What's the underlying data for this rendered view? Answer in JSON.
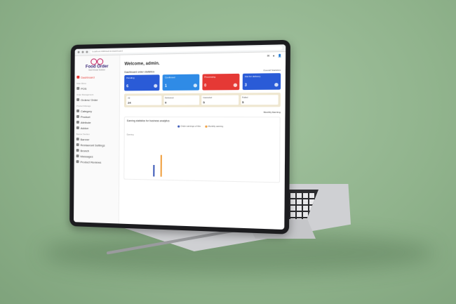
{
  "browser": {
    "url": "localhost:4000/admin/dashboard"
  },
  "brand": {
    "title": "Food Order",
    "subtitle": "Multi Vendor Solution",
    "accent": "#c2185b"
  },
  "sidebar": {
    "sections": [
      "Main Menu",
      "Order Management",
      "Product Manage",
      "Banner Section"
    ],
    "items": [
      {
        "label": "Dashboard",
        "icon": "home-icon",
        "active": true
      },
      {
        "label": "POS",
        "icon": "cart-icon"
      },
      {
        "label": "Orders/ Order",
        "icon": "bag-icon"
      },
      {
        "label": "Category",
        "icon": "grid-icon"
      },
      {
        "label": "Product",
        "icon": "box-icon"
      },
      {
        "label": "Attribute",
        "icon": "tag-icon"
      },
      {
        "label": "Addon",
        "icon": "plus-icon"
      },
      {
        "label": "Banner",
        "icon": "image-icon"
      },
      {
        "label": "Restaurant Settings",
        "icon": "gear-icon"
      },
      {
        "label": "Branch",
        "icon": "store-icon"
      },
      {
        "label": "Messages",
        "icon": "chat-icon"
      },
      {
        "label": "Product Reviews",
        "icon": "star-icon"
      }
    ]
  },
  "main": {
    "welcome": "Welcome, admin.",
    "stats_title": "Dashboard order statistics",
    "stats_filter": "Overall Statistics",
    "cards": [
      {
        "label": "Pending",
        "value": "6",
        "color": "#2a5bd7"
      },
      {
        "label": "Confirmed",
        "value": "1",
        "color": "#2f8be6"
      },
      {
        "label": "Processing",
        "value": "0",
        "color": "#e53935"
      },
      {
        "label": "Out for delivery",
        "value": "3",
        "color": "#2a5bd7"
      }
    ],
    "mini": [
      {
        "label": "All",
        "value": "24"
      },
      {
        "label": "Delivered",
        "value": "0"
      },
      {
        "label": "Canceled",
        "value": "5"
      },
      {
        "label": "Failed",
        "value": "5"
      }
    ],
    "dash_label": "Monthly Earning",
    "panel": {
      "title": "Earning statistics for business analytics",
      "legend": [
        {
          "label": "Order earnings of this",
          "color": "#3d5ab8"
        },
        {
          "label": "Monthly earning",
          "color": "#f0a040"
        }
      ],
      "axis_label": "Earning"
    }
  }
}
